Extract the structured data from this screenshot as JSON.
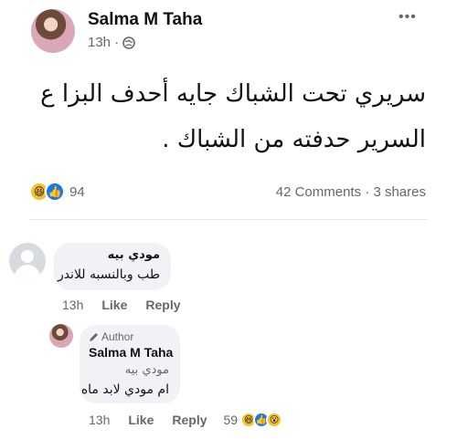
{
  "post": {
    "author": "Salma M Taha",
    "time": "13h ·",
    "text_line1": "سريري تحت الشباك جايه أحدف البزا ع",
    "text_line2": "السرير حدفته من الشباك .",
    "reaction_count": "94",
    "comments": "42 Comments",
    "shares": "3 shares",
    "more_label": "•••"
  },
  "comment1": {
    "name": "مودي بيه",
    "text": "طب وبالنسبه للاندر",
    "time": "13h",
    "like": "Like",
    "reply": "Reply"
  },
  "reply1": {
    "badge": "Author",
    "name": "Salma M Taha",
    "tag": "مودي بيه",
    "text": "ام مودي لابد ماه",
    "time": "13h",
    "like": "Like",
    "reply": "Reply",
    "reaction_count": "59"
  },
  "colors": {
    "like_blue": "#1877f2",
    "grey_text": "#65676b",
    "bubble": "#f0f2f5"
  },
  "icons": [
    "globe-icon",
    "more-icon",
    "haha-icon",
    "like-icon",
    "wow-icon",
    "pencil-icon"
  ]
}
